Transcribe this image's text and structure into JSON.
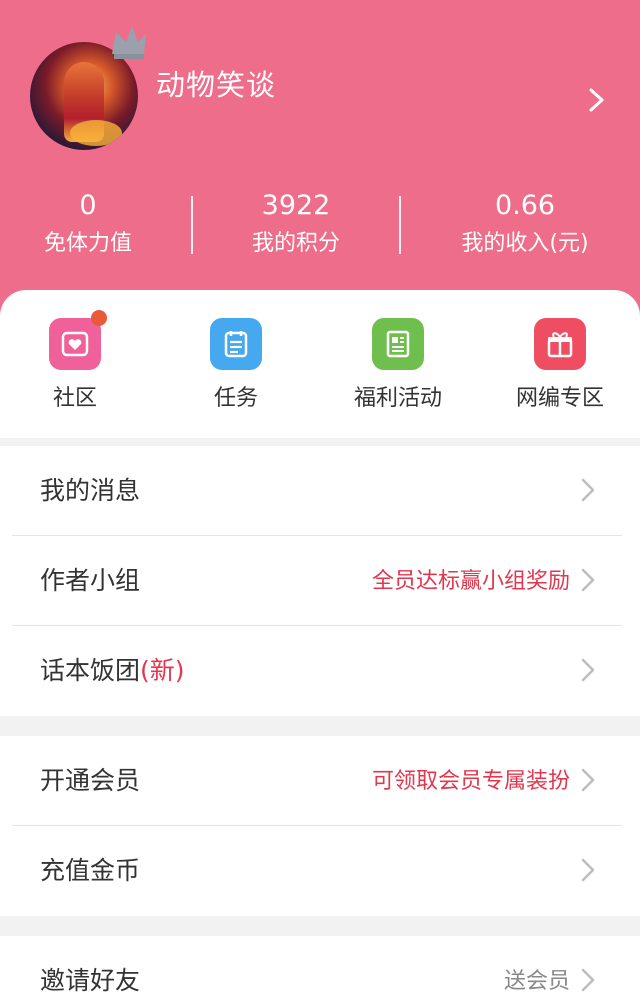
{
  "profile": {
    "username": "动物笑谈"
  },
  "stats": [
    {
      "value": "0",
      "label": "免体力值"
    },
    {
      "value": "3922",
      "label": "我的积分"
    },
    {
      "value": "0.66",
      "label": "我的收入(元)"
    }
  ],
  "grid": [
    {
      "label": "社区",
      "icon": "community-icon",
      "color": "#f0609a",
      "badge": true
    },
    {
      "label": "任务",
      "icon": "tasks-icon",
      "color": "#46a8ee",
      "badge": false
    },
    {
      "label": "福利活动",
      "icon": "welfare-icon",
      "color": "#6fbf4e",
      "badge": false
    },
    {
      "label": "网编专区",
      "icon": "gift-icon",
      "color": "#ee4d62",
      "badge": false
    }
  ],
  "menu": {
    "messages": {
      "label": "我的消息"
    },
    "author_group": {
      "label": "作者小组",
      "hint": "全员达标赢小组奖励"
    },
    "script_fans": {
      "label": "话本饭团",
      "tag": "(新)"
    },
    "vip": {
      "label": "开通会员",
      "hint": "可领取会员专属装扮"
    },
    "recharge": {
      "label": "充值金币"
    },
    "invite": {
      "label": "邀请好友",
      "hint": "送会员"
    }
  },
  "colors": {
    "header": "#ee6d8a",
    "accent_red": "#e2374e",
    "badge_dot": "#e85a3a"
  }
}
